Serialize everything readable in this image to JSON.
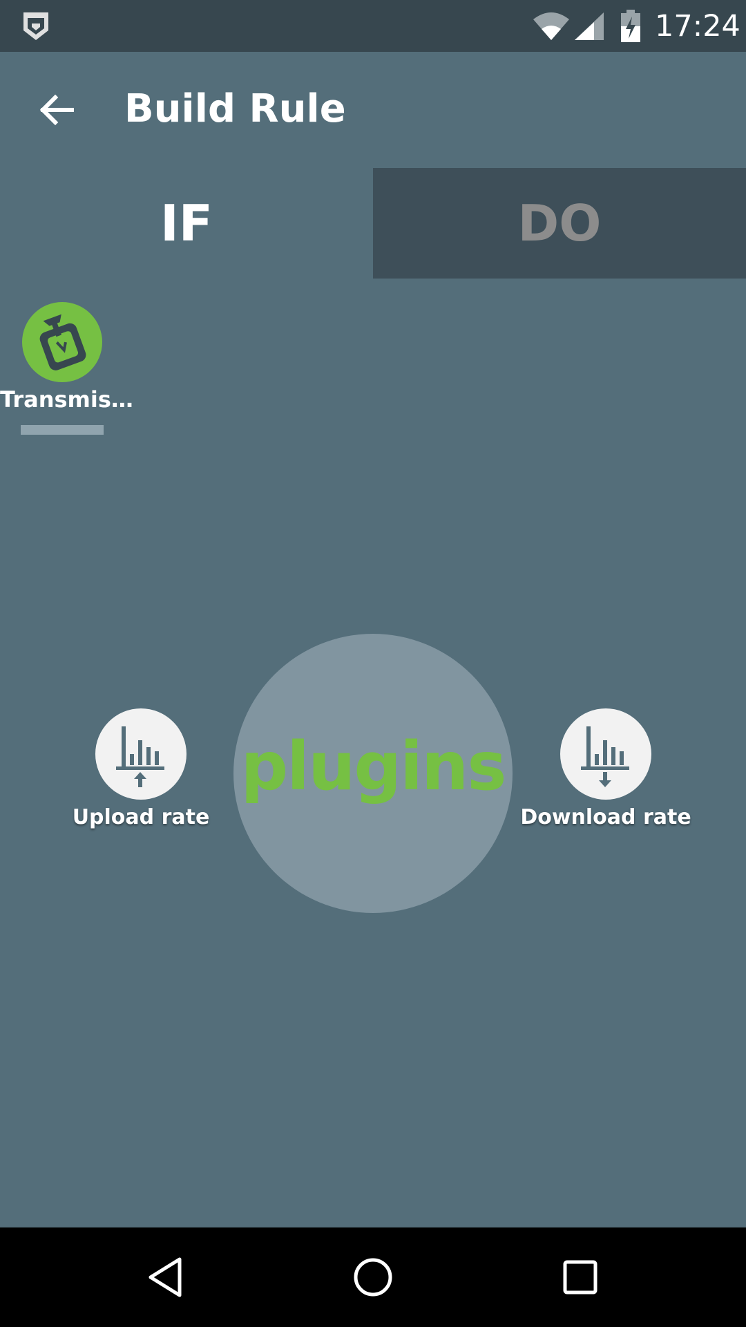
{
  "status_bar": {
    "time": "17:24",
    "icons": [
      "shield-icon",
      "wifi-icon",
      "signal-icon",
      "battery-charging-icon"
    ]
  },
  "app_bar": {
    "title": "Build Rule",
    "back_icon": "arrow-left-icon"
  },
  "tabs": [
    {
      "label": "IF",
      "selected": true
    },
    {
      "label": "DO",
      "selected": false
    }
  ],
  "selected_plugins": [
    {
      "label": "Transmis…",
      "icon": "transmission-plugin-icon",
      "accent": "#76c043"
    }
  ],
  "hub": {
    "label": "plugins",
    "color": "#76c043"
  },
  "plugin_options": {
    "upload": {
      "label": "Upload rate",
      "icon": "upload-rate-icon"
    },
    "download": {
      "label": "Download rate",
      "icon": "download-rate-icon"
    }
  },
  "nav_bar": {
    "icons": [
      "nav-back-icon",
      "nav-home-icon",
      "nav-recents-icon"
    ]
  },
  "colors": {
    "background": "#546e7a",
    "status_bar": "#37474f",
    "tab_inactive": "#3e4f59",
    "accent": "#76c043"
  }
}
